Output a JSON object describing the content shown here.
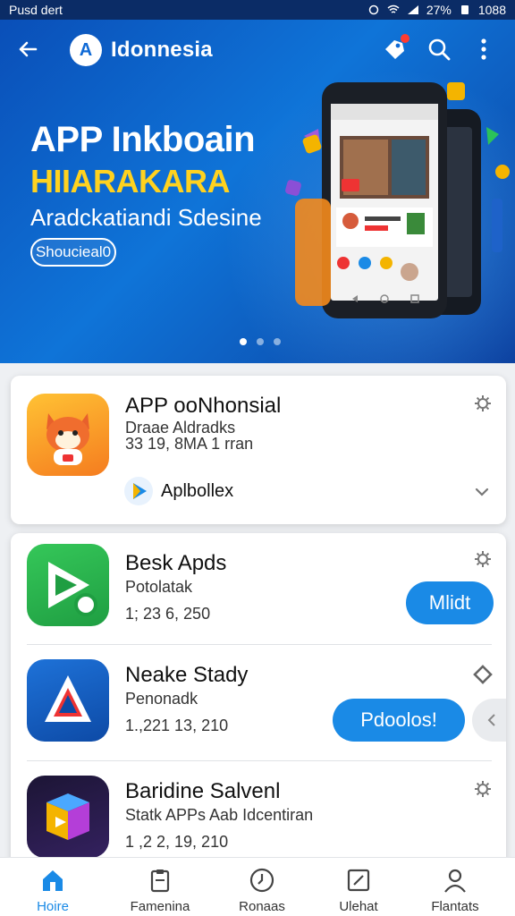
{
  "status_bar": {
    "left_text": "Pusd dert",
    "battery": "27%",
    "time": "1088"
  },
  "header": {
    "app_name": "Idonnesia",
    "logo_letter": "A"
  },
  "hero": {
    "title": "APP Inkboain",
    "subtitle": "HIIARAKARA",
    "description": "Aradckatiandi Sdesine",
    "button_label": "Shoucieal0",
    "pager": {
      "count": 3,
      "active_index": 0
    }
  },
  "featured": {
    "title": "APP ooNhonsial",
    "subtitle": "Draae Aldradks",
    "meta": "33 19, 8MA 1 rran",
    "developer": "Aplbollex"
  },
  "apps": [
    {
      "title": "Besk Apds",
      "subtitle": "Potolatak",
      "meta": "1; 23 6, 250",
      "action_label": "Mlidt"
    },
    {
      "title": "Neake Stady",
      "subtitle": "Penonadk",
      "meta": "1.,221 13, 210",
      "action_label": "Pdoolos!"
    },
    {
      "title": "Baridine Salvenl",
      "subtitle": "Statk APPs Aab Idcentiran",
      "meta": "1 ,2 2, 19, 210"
    }
  ],
  "bottom_nav": [
    {
      "label": "Hoire",
      "icon": "home-icon",
      "active": true
    },
    {
      "label": "Famenina",
      "icon": "clipboard-icon",
      "active": false
    },
    {
      "label": "Ronaas",
      "icon": "clock-icon",
      "active": false
    },
    {
      "label": "Ulehat",
      "icon": "calendar-icon",
      "active": false
    },
    {
      "label": "Flantats",
      "icon": "person-icon",
      "active": false
    }
  ],
  "colors": {
    "accent": "#1a8ae6",
    "hero_blue": "#0f74d8",
    "hero_yellow": "#ffd21f"
  }
}
